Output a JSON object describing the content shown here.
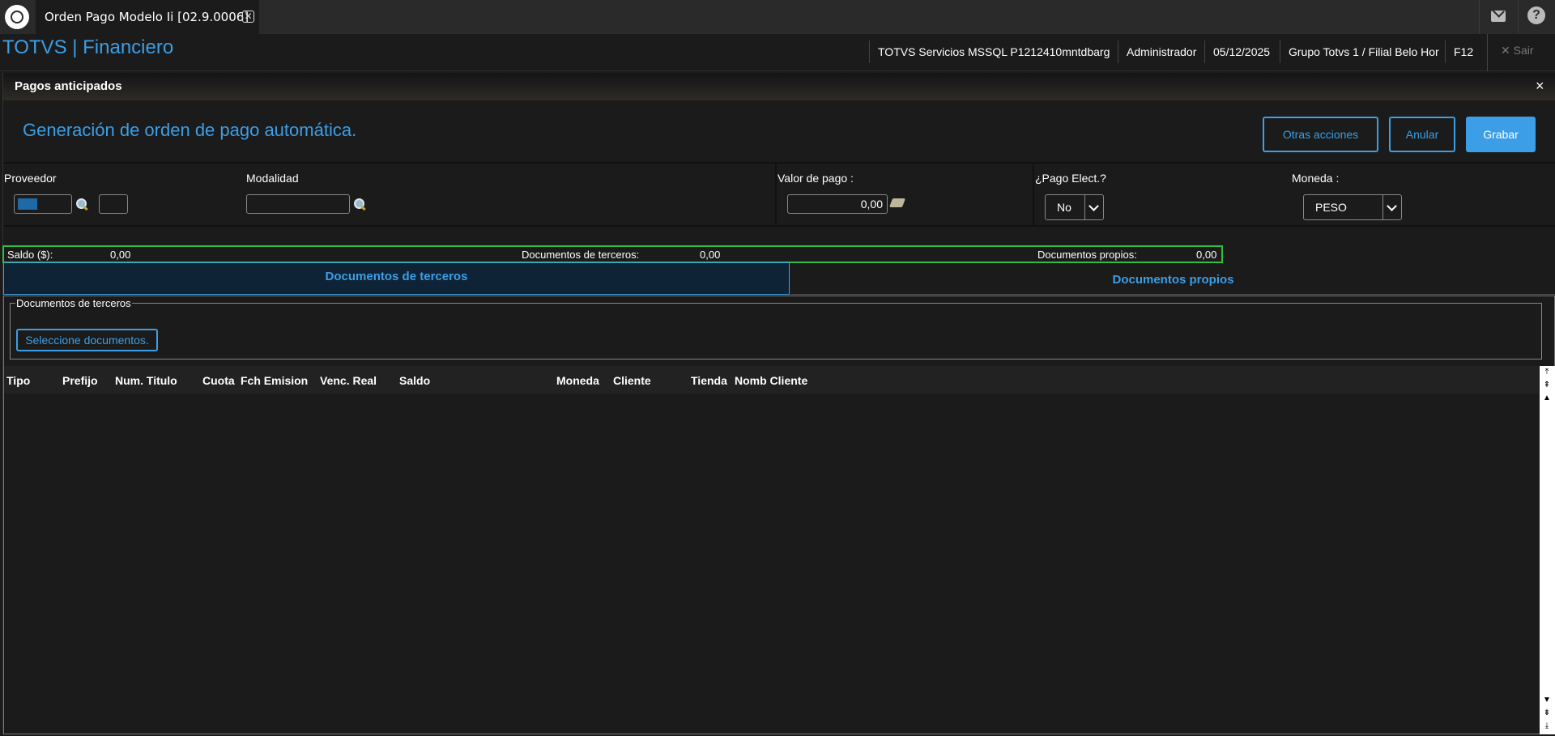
{
  "tab": {
    "title": "Orden Pago Modelo Ii [02.9.0006]",
    "close_symbol": "✕"
  },
  "topbar": {
    "mail_icon": "mail-icon",
    "help_icon": "help-icon",
    "help_symbol": "?"
  },
  "header": {
    "brand": "TOTVS | Financiero",
    "environment": "TOTVS Servicios MSSQL P1212410mntdbarg",
    "user": "Administrador",
    "date": "05/12/2025",
    "branch": "Grupo Totvs 1 / Filial Belo Hor",
    "shortcut": "F12",
    "exit_label": "✕  Sair"
  },
  "dialog": {
    "title": "Pagos anticipados",
    "close_symbol": "×",
    "subtitle": "Generación de orden de pago automática.",
    "buttons": {
      "other_actions": "Otras acciones",
      "cancel": "Anular",
      "save": "Grabar"
    }
  },
  "form": {
    "supplier_label": "Proveedor",
    "modality_label": "Modalidad",
    "payment_value_label": "Valor de pago :",
    "payment_value": "0,00",
    "electronic_label": "¿Pago Elect.?",
    "electronic_value": "No",
    "currency_label": "Moneda :",
    "currency_value": "PESO"
  },
  "totals": {
    "balance_label": "Saldo ($):",
    "balance_value": "0,00",
    "third_label": "Documentos de terceros:",
    "third_value": "0,00",
    "own_label": "Documentos propios:",
    "own_value": "0,00"
  },
  "tabs": {
    "third": "Documentos de terceros",
    "own": "Documentos propios"
  },
  "group": {
    "legend": "Documentos de terceros",
    "select_button": "Seleccione documentos."
  },
  "grid": {
    "columns": [
      "Tipo",
      "Prefijo",
      "Num. Titulo",
      "Cuota",
      "Fch Emision",
      "Venc. Real",
      "Saldo",
      "Moneda",
      "Cliente",
      "Tienda",
      "Nomb Cliente"
    ]
  },
  "colors": {
    "accent": "#3c9ee6",
    "highlight": "#2fbf3a",
    "background": "#1b1b1b"
  }
}
